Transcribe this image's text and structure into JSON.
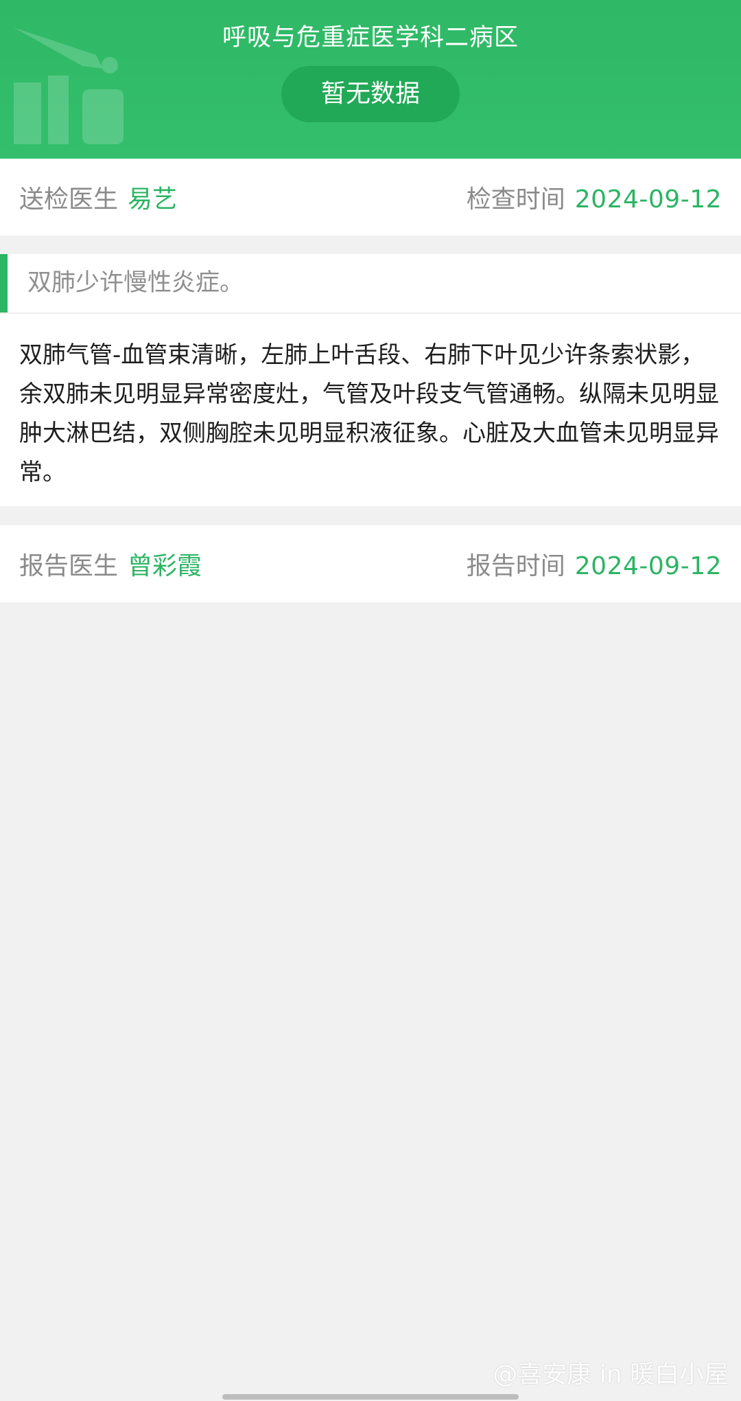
{
  "header": {
    "department": "呼吸与危重症医学科二病区",
    "status": "暂无数据"
  },
  "exam": {
    "sender_label": "送检医生",
    "sender_name": "易艺",
    "exam_time_label": "检查时间",
    "exam_time": "2024-09-12"
  },
  "impression": "双肺少许慢性炎症。",
  "findings": "双肺气管-血管束清晰，左肺上叶舌段、右肺下叶见少许条索状影，余双肺未见明显异常密度灶，气管及叶段支气管通畅。纵隔未见明显肿大淋巴结，双侧胸腔未见明显积液征象。心脏及大血管未见明显异常。",
  "report": {
    "doctor_label": "报告医生",
    "doctor_name": "曾彩霞",
    "report_time_label": "报告时间",
    "report_time": "2024-09-12"
  },
  "watermark": "@喜安康 in 暖白小屋",
  "colors": {
    "accent": "#2bb463",
    "header_bg": "#33bf6c",
    "label_gray": "#8a8a8a"
  }
}
